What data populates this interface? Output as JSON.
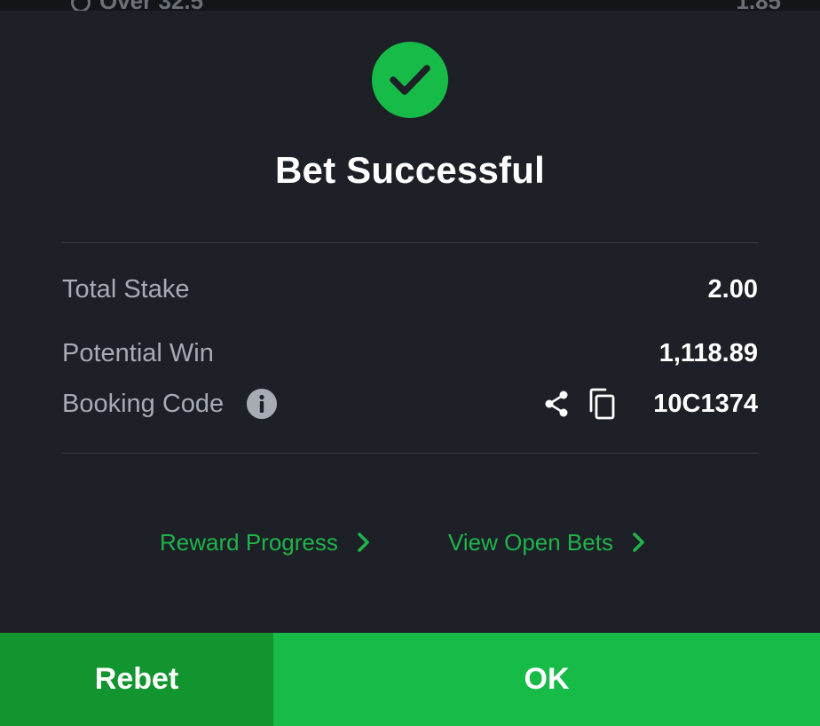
{
  "top_strip": {
    "left_text": "Over 32.5",
    "right_text": "1.85"
  },
  "title": "Bet Successful",
  "summary": {
    "total_stake_label": "Total Stake",
    "total_stake_value": "2.00",
    "potential_win_label": "Potential Win",
    "potential_win_value": "1,118.89",
    "booking_code_label": "Booking Code",
    "booking_code_value": "10C1374"
  },
  "links": {
    "reward_progress": "Reward Progress",
    "view_open_bets": "View Open Bets"
  },
  "buttons": {
    "rebet": "Rebet",
    "ok": "OK"
  },
  "icons": {
    "success": "check-circle-icon",
    "info": "info-icon",
    "share": "share-icon",
    "copy": "copy-icon",
    "chevron": "chevron-right-icon"
  },
  "colors": {
    "background": "#1d2026",
    "accent_green": "#17bb47",
    "dark_green": "#12952f",
    "link_green": "#1fb34b",
    "label_gray": "#a7abb3"
  }
}
